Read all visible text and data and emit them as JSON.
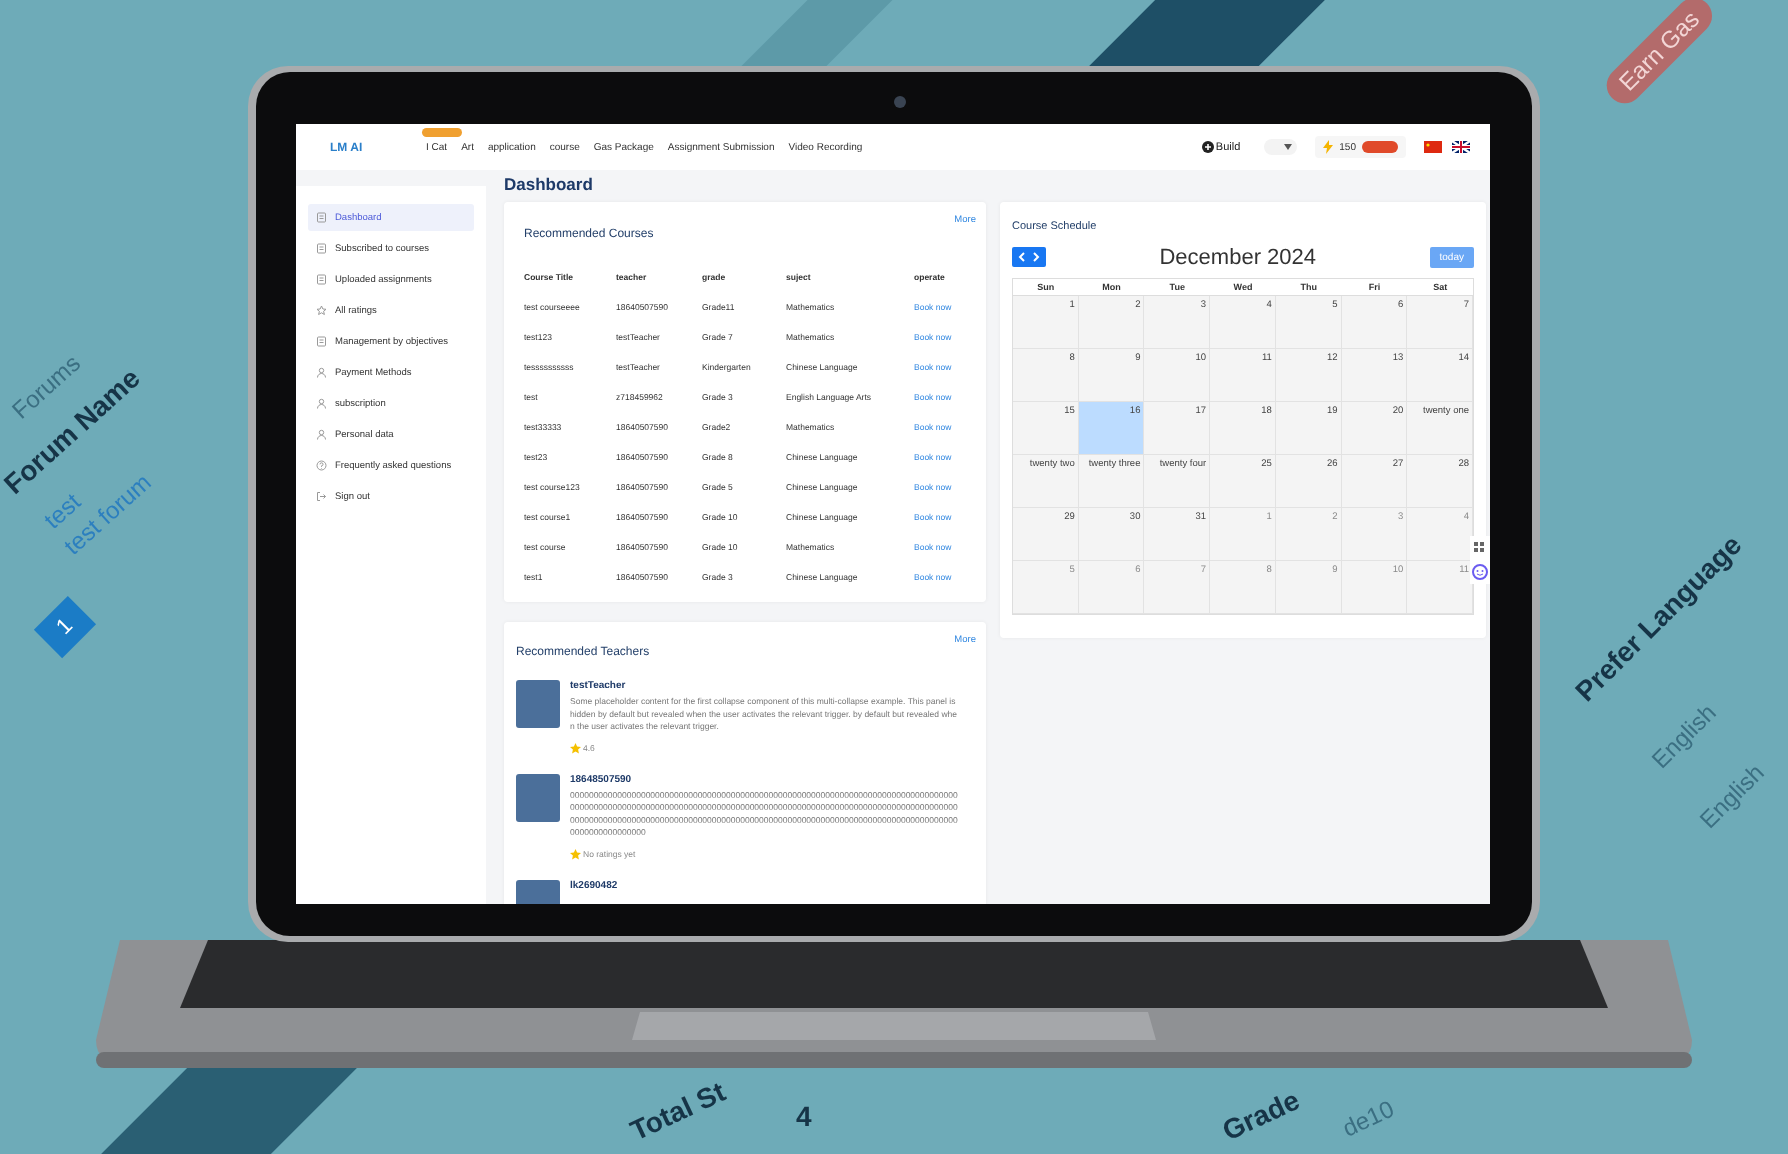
{
  "background_labels": [
    {
      "text": "Forums",
      "kind": "text"
    },
    {
      "text": "Forum Name",
      "kind": "heading"
    },
    {
      "text": "test",
      "kind": "link"
    },
    {
      "text": "test forum",
      "kind": "link"
    },
    {
      "text": "Earn Gas",
      "kind": "pill"
    },
    {
      "text": "Prefer Language",
      "kind": "heading"
    },
    {
      "text": "English",
      "kind": "text"
    },
    {
      "text": "English",
      "kind": "text"
    },
    {
      "text": "Total St",
      "kind": "heading"
    },
    {
      "text": "4",
      "kind": "heading"
    },
    {
      "text": "Grade",
      "kind": "heading"
    },
    {
      "text": "de10",
      "kind": "text"
    },
    {
      "text": "1",
      "kind": "page"
    }
  ],
  "nav": {
    "logo": "LM AI",
    "items": [
      "I Cat",
      "Art",
      "application",
      "course",
      "Gas Package",
      "Assignment Submission",
      "Video Recording"
    ],
    "build": "Build",
    "points": "150"
  },
  "page_title": "Dashboard",
  "sidebar": {
    "items": [
      {
        "label": "Dashboard",
        "selected": true
      },
      {
        "label": "Subscribed to courses",
        "selected": false
      },
      {
        "label": "Uploaded assignments",
        "selected": false
      },
      {
        "label": "All ratings",
        "selected": false
      },
      {
        "label": "Management by objectives",
        "selected": false
      },
      {
        "label": "Payment Methods",
        "selected": false
      },
      {
        "label": "subscription",
        "selected": false
      },
      {
        "label": "Personal data",
        "selected": false
      },
      {
        "label": "Frequently asked questions",
        "selected": false
      },
      {
        "label": "Sign out",
        "selected": false
      }
    ]
  },
  "courses": {
    "title": "Recommended Courses",
    "more": "More",
    "columns": [
      "Course Title",
      "teacher",
      "grade",
      "suject",
      "operate"
    ],
    "rows": [
      {
        "cells": [
          "test courseeee",
          "18640507590",
          "Grade11",
          "Mathematics"
        ],
        "action": "Book now"
      },
      {
        "cells": [
          "test123",
          "testTeacher",
          "Grade 7",
          "Mathematics"
        ],
        "action": "Book now"
      },
      {
        "cells": [
          "tessssssssss",
          "testTeacher",
          "Kindergarten",
          "Chinese Language"
        ],
        "action": "Book now"
      },
      {
        "cells": [
          "test",
          "z718459962",
          "Grade 3",
          "English Language Arts"
        ],
        "action": "Book now"
      },
      {
        "cells": [
          "test33333",
          "18640507590",
          "Grade2",
          "Mathematics"
        ],
        "action": "Book now"
      },
      {
        "cells": [
          "test23",
          "18640507590",
          "Grade 8",
          "Chinese Language"
        ],
        "action": "Book now"
      },
      {
        "cells": [
          "test course123",
          "18640507590",
          "Grade 5",
          "Chinese Language"
        ],
        "action": "Book now"
      },
      {
        "cells": [
          "test course1",
          "18640507590",
          "Grade 10",
          "Chinese Language"
        ],
        "action": "Book now"
      },
      {
        "cells": [
          "test course",
          "18640507590",
          "Grade 10",
          "Mathematics"
        ],
        "action": "Book now"
      },
      {
        "cells": [
          "test1",
          "18640507590",
          "Grade 3",
          "Chinese Language"
        ],
        "action": "Book now"
      }
    ]
  },
  "schedule": {
    "title": "Course Schedule",
    "month": "December 2024",
    "today": "today",
    "weekdays": [
      "Sun",
      "Mon",
      "Tue",
      "Wed",
      "Thu",
      "Fri",
      "Sat"
    ],
    "days": [
      {
        "label": "1",
        "other_month": false,
        "selected": false
      },
      {
        "label": "2",
        "other_month": false,
        "selected": false
      },
      {
        "label": "3",
        "other_month": false,
        "selected": false
      },
      {
        "label": "4",
        "other_month": false,
        "selected": false
      },
      {
        "label": "5",
        "other_month": false,
        "selected": false
      },
      {
        "label": "6",
        "other_month": false,
        "selected": false
      },
      {
        "label": "7",
        "other_month": false,
        "selected": false
      },
      {
        "label": "8",
        "other_month": false,
        "selected": false
      },
      {
        "label": "9",
        "other_month": false,
        "selected": false
      },
      {
        "label": "10",
        "other_month": false,
        "selected": false
      },
      {
        "label": "11",
        "other_month": false,
        "selected": false
      },
      {
        "label": "12",
        "other_month": false,
        "selected": false
      },
      {
        "label": "13",
        "other_month": false,
        "selected": false
      },
      {
        "label": "14",
        "other_month": false,
        "selected": false
      },
      {
        "label": "15",
        "other_month": false,
        "selected": false
      },
      {
        "label": "16",
        "other_month": false,
        "selected": true
      },
      {
        "label": "17",
        "other_month": false,
        "selected": false
      },
      {
        "label": "18",
        "other_month": false,
        "selected": false
      },
      {
        "label": "19",
        "other_month": false,
        "selected": false
      },
      {
        "label": "20",
        "other_month": false,
        "selected": false
      },
      {
        "label": "twenty one",
        "other_month": false,
        "selected": false
      },
      {
        "label": "twenty two",
        "other_month": false,
        "selected": false
      },
      {
        "label": "twenty three",
        "other_month": false,
        "selected": false
      },
      {
        "label": "twenty four",
        "other_month": false,
        "selected": false
      },
      {
        "label": "25",
        "other_month": false,
        "selected": false
      },
      {
        "label": "26",
        "other_month": false,
        "selected": false
      },
      {
        "label": "27",
        "other_month": false,
        "selected": false
      },
      {
        "label": "28",
        "other_month": false,
        "selected": false
      },
      {
        "label": "29",
        "other_month": false,
        "selected": false
      },
      {
        "label": "30",
        "other_month": false,
        "selected": false
      },
      {
        "label": "31",
        "other_month": false,
        "selected": false
      },
      {
        "label": "1",
        "other_month": true,
        "selected": false
      },
      {
        "label": "2",
        "other_month": true,
        "selected": false
      },
      {
        "label": "3",
        "other_month": true,
        "selected": false
      },
      {
        "label": "4",
        "other_month": true,
        "selected": false
      },
      {
        "label": "5",
        "other_month": true,
        "selected": false
      },
      {
        "label": "6",
        "other_month": true,
        "selected": false
      },
      {
        "label": "7",
        "other_month": true,
        "selected": false
      },
      {
        "label": "8",
        "other_month": true,
        "selected": false
      },
      {
        "label": "9",
        "other_month": true,
        "selected": false
      },
      {
        "label": "10",
        "other_month": true,
        "selected": false
      },
      {
        "label": "11",
        "other_month": true,
        "selected": false
      }
    ]
  },
  "teachers": {
    "title": "Recommended Teachers",
    "more": "More",
    "items": [
      {
        "name": "testTeacher",
        "bio": "Some placeholder content for the first collapse component of this multi-collapse example. This panel is hidden by default but revealed when the user activates the relevant trigger. by default but revealed when the user activates the relevant trigger.",
        "rating": "4.6"
      },
      {
        "name": "18648507590",
        "bio": "0000000000000000000000000000000000000000000000000000000000000000000000000000000000000000000000000000000000000000000000000000000000000000000000000000000000000000000000000000000000000000000000000000000000000000000000000000000000000000000000000000000000000000000000",
        "rating": "No ratings yet"
      },
      {
        "name": "lk2690482"
      }
    ]
  }
}
